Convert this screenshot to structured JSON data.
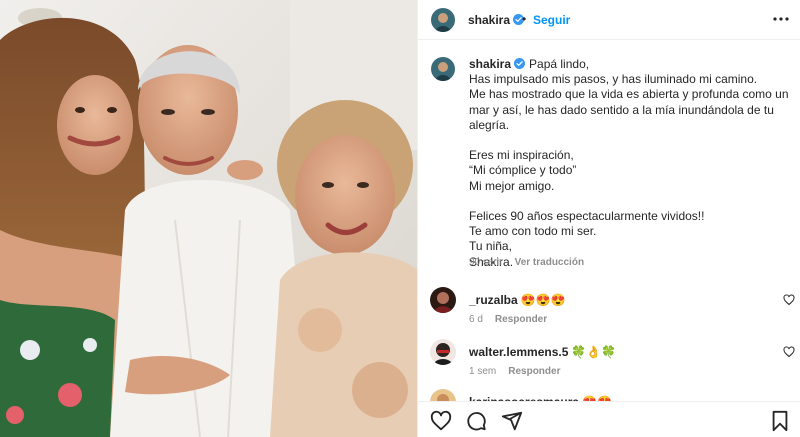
{
  "post": {
    "username": "shakira",
    "follow_label": "Seguir",
    "separator": "•"
  },
  "caption": {
    "username": "shakira",
    "text": "Papá lindo,\nHas impulsado mis pasos, y has iluminado mi camino.\nMe has mostrado que la vida es abierta y profunda como un mar y así, le has dado sentido a la mía inundándola de tu alegría.\n\nEres mi inspiración,\n“Mi cómplice y todo”\nMi mejor amigo.\n\nFelices 90 años espectacularmente vividos!!\nTe amo con todo mi ser.\nTu niña,\nShakira.",
    "age": "90 sem",
    "translate_label": "Ver traducción"
  },
  "comments": [
    {
      "username": "_ruzalba",
      "text": "😍😍😍",
      "age": "6 d",
      "reply_label": "Responder"
    },
    {
      "username": "walter.lemmens.5",
      "text": "🍀👌🍀",
      "age": "1 sem",
      "reply_label": "Responder"
    },
    {
      "username": "karinasoaresmaura",
      "text": "😍😍",
      "age": "",
      "reply_label": ""
    }
  ],
  "icons": {
    "verified": "verified-badge-icon",
    "more": "more-options-icon",
    "heart": "heart-icon",
    "comment": "comment-icon",
    "share": "share-icon",
    "save": "bookmark-icon"
  },
  "colors": {
    "accent": "#0095f6",
    "text": "#262626",
    "muted": "#8e8e8e",
    "verified": "#3897f0"
  }
}
